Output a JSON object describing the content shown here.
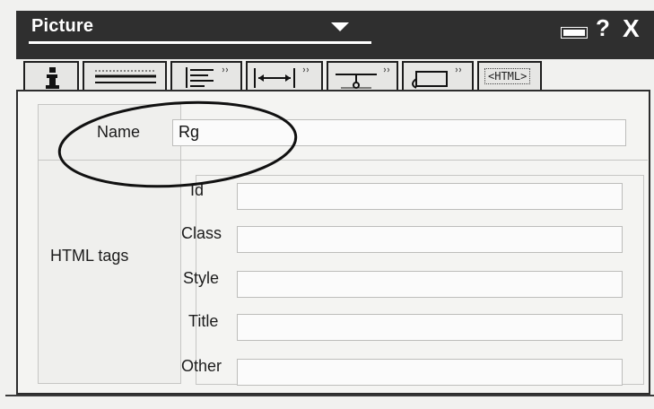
{
  "window": {
    "title": "Picture",
    "help_label": "?",
    "close_label": "X"
  },
  "tabs": [
    {
      "name": "info-tab",
      "icon": "info-icon"
    },
    {
      "name": "border-tab",
      "icon": "horizontal-lines-icon"
    },
    {
      "name": "align-tab",
      "icon": "align-left-icon"
    },
    {
      "name": "size-tab",
      "icon": "width-arrows-icon"
    },
    {
      "name": "spacing-tab",
      "icon": "baseline-spacing-icon"
    },
    {
      "name": "link-tab",
      "icon": "link-tag-icon"
    },
    {
      "name": "html-tab",
      "label": "HTML",
      "icon": "html-tag-icon"
    }
  ],
  "form": {
    "name_label": "Name",
    "name_value": "Rg",
    "group_label": "HTML tags",
    "fields": [
      {
        "label": "Id",
        "value": ""
      },
      {
        "label": "Class",
        "value": ""
      },
      {
        "label": "Style",
        "value": ""
      },
      {
        "label": "Title",
        "value": ""
      },
      {
        "label": "Other",
        "value": ""
      }
    ]
  },
  "annotation": {
    "type": "ellipse-highlight",
    "target": "name-field"
  },
  "colors": {
    "titlebar": "#2f2f2f",
    "panel_bg": "#f4f4f2",
    "field_bg": "#fbfbfb",
    "border": "#2d2d2d"
  }
}
